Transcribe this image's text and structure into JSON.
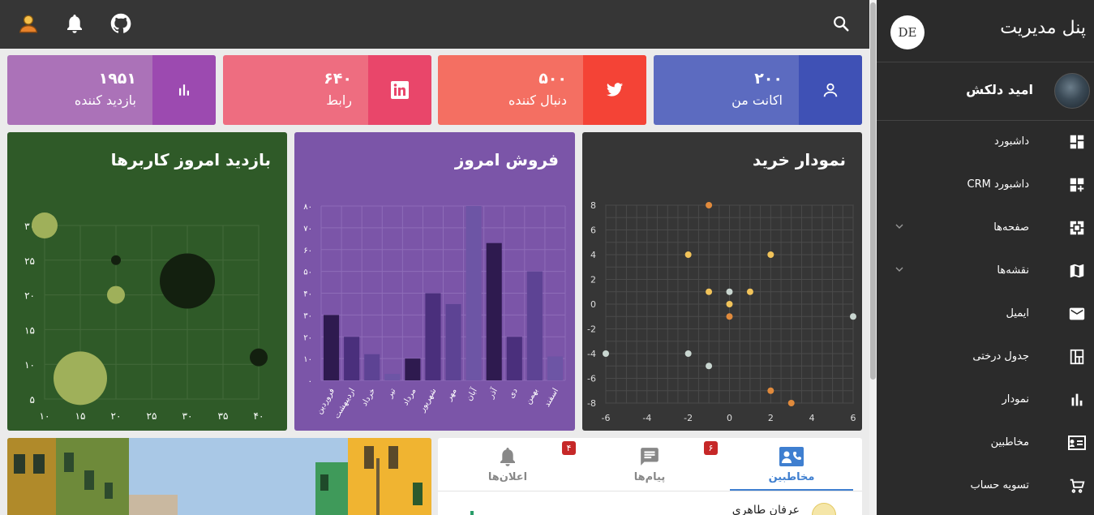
{
  "sidebar": {
    "title": "پنل مدیریت",
    "logo_text": "DE",
    "user_name": "امید دلکش",
    "items": [
      {
        "label": "داشبورد",
        "icon": "dashboard-icon"
      },
      {
        "label": "داشبورد CRM",
        "icon": "dashboard-add-icon"
      },
      {
        "label": "صفحه‌ها",
        "icon": "pages-icon",
        "expandable": true
      },
      {
        "label": "نقشه‌ها",
        "icon": "map-icon",
        "expandable": true
      },
      {
        "label": "ایمیل",
        "icon": "email-icon"
      },
      {
        "label": "جدول درختی",
        "icon": "tree-table-icon"
      },
      {
        "label": "نمودار",
        "icon": "bar-chart-icon"
      },
      {
        "label": "مخاطبین",
        "icon": "contacts-icon"
      },
      {
        "label": "تسویه حساب",
        "icon": "checkout-icon"
      }
    ]
  },
  "topbar": {
    "icons": [
      "search-icon",
      "github-icon",
      "bell-icon",
      "user-icon"
    ]
  },
  "stats": [
    {
      "value": "۲۰۰",
      "caption": "اکانت من",
      "icon": "user-icon",
      "bg": "#5c6bc0",
      "accent": "#3f51b5"
    },
    {
      "value": "۵۰۰",
      "caption": "دنبال کننده",
      "icon": "twitter-icon",
      "bg": "#f46f62",
      "accent": "#f44336"
    },
    {
      "value": "۶۴۰",
      "caption": "رابط",
      "icon": "linkedin-icon",
      "bg": "#ee6d80",
      "accent": "#e9466a"
    },
    {
      "value": "۱۹۵۱",
      "caption": "بازدید کننده",
      "icon": "bar-chart-icon",
      "bg": "#ab72b8",
      "accent": "#9c4ab0"
    }
  ],
  "charts": {
    "scatter_title": "نمودار خرید",
    "bar_title": "فروش امروز",
    "bubble_title": "بازدید امروز کاربرها"
  },
  "chart_data": [
    {
      "type": "scatter",
      "title": "نمودار خرید",
      "x_ticks": [
        "-6",
        "-4",
        "-2",
        "0",
        "2",
        "4",
        "6"
      ],
      "y_ticks": [
        "8",
        "6",
        "4",
        "2",
        "0",
        "-2",
        "-4",
        "-6",
        "-8"
      ],
      "xlim": [
        -6,
        6
      ],
      "ylim": [
        -8,
        8
      ],
      "series": [
        {
          "color": "#f1c35a",
          "points": [
            [
              -2,
              4
            ],
            [
              2,
              4
            ],
            [
              -1,
              1
            ],
            [
              1,
              1
            ],
            [
              0,
              0
            ]
          ]
        },
        {
          "color": "#e08a3c",
          "points": [
            [
              -1,
              8
            ],
            [
              0,
              -1
            ],
            [
              2,
              -7
            ],
            [
              3,
              -8
            ]
          ]
        },
        {
          "color": "#c9d6d0",
          "points": [
            [
              0,
              1
            ],
            [
              6,
              -1
            ],
            [
              -6,
              -4
            ],
            [
              -2,
              -4
            ],
            [
              -1,
              -5
            ]
          ]
        }
      ]
    },
    {
      "type": "bar",
      "title": "فروش امروز",
      "categories": [
        "فروردین",
        "اردیبهشت",
        "خرداد",
        "تیر",
        "مرداد",
        "شهریور",
        "مهر",
        "آبان",
        "آذر",
        "دی",
        "بهمن",
        "اسفند"
      ],
      "values": [
        30,
        20,
        12,
        3,
        10,
        40,
        35,
        80,
        63,
        20,
        50,
        11
      ],
      "colors": [
        "#2e1a4f",
        "#4a2f7c",
        "#5d4394",
        "#6d55a5",
        "#2e1a4f",
        "#4a2f7c",
        "#5d4394",
        "#6d55a5",
        "#2e1a4f",
        "#4a2f7c",
        "#5d4394",
        "#6d55a5"
      ],
      "y_ticks": [
        "۰",
        "۱۰",
        "۲۰",
        "۳۰",
        "۴۰",
        "۵۰",
        "۶۰",
        "۷۰",
        "۸۰"
      ],
      "ylim": [
        0,
        80
      ]
    },
    {
      "type": "scatter",
      "title": "بازدید امروز کاربرها",
      "x_ticks": [
        "۱۰",
        "۱۵",
        "۲۰",
        "۲۵",
        "۳۰",
        "۳۵",
        "۴۰"
      ],
      "y_ticks": [
        "۳۰",
        "۲۵",
        "۲۰",
        "۱۵",
        "۱۰",
        "۵"
      ],
      "xlim": [
        10,
        40
      ],
      "ylim": [
        5,
        30
      ],
      "bubbles": [
        {
          "x": 10,
          "y": 30,
          "r": 16,
          "color": "#9fb05a"
        },
        {
          "x": 20,
          "y": 25,
          "r": 6,
          "color": "#13200f"
        },
        {
          "x": 20,
          "y": 20,
          "r": 11,
          "color": "#9fb05a"
        },
        {
          "x": 30,
          "y": 22,
          "r": 34,
          "color": "#13200f"
        },
        {
          "x": 15,
          "y": 8,
          "r": 33,
          "color": "#9fb05a"
        },
        {
          "x": 40,
          "y": 11,
          "r": 11,
          "color": "#13200f"
        }
      ]
    }
  ],
  "tabs": {
    "items": [
      {
        "label": "مخاطبین",
        "icon": "contacts-phone-icon",
        "badge": ""
      },
      {
        "label": "پیام‌ها",
        "icon": "message-icon",
        "badge": "۶"
      },
      {
        "label": "اعلان‌ها",
        "icon": "bell-icon",
        "badge": "۴"
      }
    ],
    "contact_name": "عرفان طاهری"
  }
}
